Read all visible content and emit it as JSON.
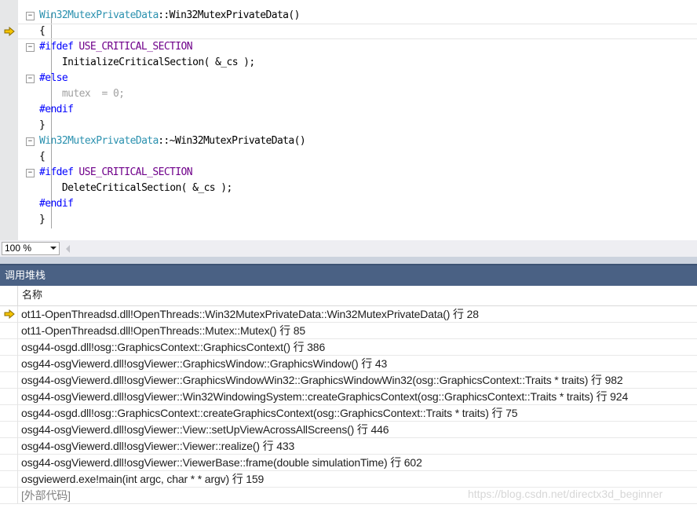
{
  "editor": {
    "lines": [
      {
        "fold": "−",
        "tokens": [
          {
            "t": "Win32MutexPrivateData",
            "c": "type"
          },
          {
            "t": "::Win32MutexPrivateData()",
            "c": "plain"
          }
        ]
      },
      {
        "fold": "",
        "current": true,
        "tokens": [
          {
            "t": "{",
            "c": "plain"
          }
        ]
      },
      {
        "fold": "−",
        "tokens": [
          {
            "t": "#ifdef",
            "c": "kw"
          },
          {
            "t": " USE_CRITICAL_SECTION",
            "c": "macro"
          }
        ]
      },
      {
        "fold": "",
        "tokens": [
          {
            "t": "    InitializeCriticalSection( &_cs );",
            "c": "plain"
          }
        ]
      },
      {
        "fold": "−",
        "tokens": [
          {
            "t": "#else",
            "c": "kw"
          }
        ]
      },
      {
        "fold": "",
        "tokens": [
          {
            "t": "    mutex  = 0;",
            "c": "gray"
          }
        ]
      },
      {
        "fold": "",
        "tokens": [
          {
            "t": "#endif",
            "c": "kw"
          }
        ]
      },
      {
        "fold": "",
        "tokens": [
          {
            "t": "}",
            "c": "plain"
          }
        ]
      },
      {
        "fold": "−",
        "tokens": [
          {
            "t": "Win32MutexPrivateData",
            "c": "type"
          },
          {
            "t": "::~Win32MutexPrivateData()",
            "c": "plain"
          }
        ]
      },
      {
        "fold": "",
        "tokens": [
          {
            "t": "{",
            "c": "plain"
          }
        ]
      },
      {
        "fold": "−",
        "tokens": [
          {
            "t": "#ifdef",
            "c": "kw"
          },
          {
            "t": " USE_CRITICAL_SECTION",
            "c": "macro"
          }
        ]
      },
      {
        "fold": "",
        "tokens": [
          {
            "t": "    DeleteCriticalSection( &_cs );",
            "c": "plain"
          }
        ]
      },
      {
        "fold": "",
        "tokens": [
          {
            "t": "#endif",
            "c": "kw"
          }
        ]
      },
      {
        "fold": "",
        "tokens": [
          {
            "t": "}",
            "c": "plain"
          }
        ]
      }
    ],
    "zoom": "100 %"
  },
  "call_stack": {
    "title": "调用堆栈",
    "column_name": "名称",
    "frames": [
      {
        "text": "ot11-OpenThreadsd.dll!OpenThreads::Win32MutexPrivateData::Win32MutexPrivateData() 行 28",
        "current": true,
        "external": false
      },
      {
        "text": "ot11-OpenThreadsd.dll!OpenThreads::Mutex::Mutex() 行 85",
        "current": false,
        "external": false
      },
      {
        "text": "osg44-osgd.dll!osg::GraphicsContext::GraphicsContext() 行 386",
        "current": false,
        "external": false
      },
      {
        "text": "osg44-osgViewerd.dll!osgViewer::GraphicsWindow::GraphicsWindow() 行 43",
        "current": false,
        "external": false
      },
      {
        "text": "osg44-osgViewerd.dll!osgViewer::GraphicsWindowWin32::GraphicsWindowWin32(osg::GraphicsContext::Traits * traits) 行 982",
        "current": false,
        "external": false
      },
      {
        "text": "osg44-osgViewerd.dll!osgViewer::Win32WindowingSystem::createGraphicsContext(osg::GraphicsContext::Traits * traits) 行 924",
        "current": false,
        "external": false
      },
      {
        "text": "osg44-osgd.dll!osg::GraphicsContext::createGraphicsContext(osg::GraphicsContext::Traits * traits) 行 75",
        "current": false,
        "external": false
      },
      {
        "text": "osg44-osgViewerd.dll!osgViewer::View::setUpViewAcrossAllScreens() 行 446",
        "current": false,
        "external": false
      },
      {
        "text": "osg44-osgViewerd.dll!osgViewer::Viewer::realize() 行 433",
        "current": false,
        "external": false
      },
      {
        "text": "osg44-osgViewerd.dll!osgViewer::ViewerBase::frame(double simulationTime) 行 602",
        "current": false,
        "external": false
      },
      {
        "text": "osgviewerd.exe!main(int argc, char * * argv) 行 159",
        "current": false,
        "external": false
      },
      {
        "text": "[外部代码]",
        "current": false,
        "external": true
      }
    ]
  },
  "watermark": "https://blog.csdn.net/directx3d_beginner",
  "colors": {
    "type": "#2b91af",
    "keyword": "#0000ff",
    "macro": "#6f008a",
    "inactive": "#a0a0a0",
    "panel_title_bg": "#4a6184",
    "exec_arrow": "#f5c400"
  },
  "icons": {
    "current_statement": "yellow-arrow-icon",
    "zoom_dropdown": "chevron-down-icon",
    "scroll_left": "scroll-left-arrow-icon"
  }
}
